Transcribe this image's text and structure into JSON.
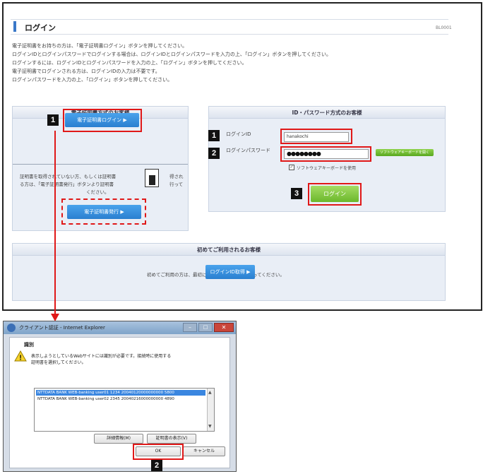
{
  "page": {
    "title": "ログイン",
    "code": "BL0001",
    "instructions": [
      "電子証明書をお持ちの方は、「電子証明書ログイン」ボタンを押してください。",
      "ログインIDとログインパスワードでログインする場合は、ログインIDとログインパスワードを入力の上、「ログイン」ボタンを押してください。",
      "ログインするには、ログインIDとログインパスワードを入力の上、「ログイン」ボタンを押してください。",
      "電子証明書でログインされる方は、ログインIDの入力は不要です。",
      "ログインパスワードを入力の上、「ログイン」ボタンを押してください。"
    ]
  },
  "cert_panel": {
    "heading": "電子証明書方式のお客様",
    "login_button": "電子証明書ログイン ▶",
    "note_line1": "証明書を取得されていない方、もしくは証明書",
    "note_line1b": "得され",
    "note_line2": "る方は、「電子証明書発行」ボタンより証明書",
    "note_line2b": "行って",
    "note_line3": "ください。",
    "issue_button": "電子証明書発行 ▶"
  },
  "id_panel": {
    "heading": "ID・パスワード方式のお客様",
    "id_label": "ログインID",
    "id_value": "hanakochi",
    "password_label": "ログインパスワード",
    "password_value": "●●●●●●●●",
    "software_keyboard_button": "ソフトウェアキーボードを開く",
    "software_keyboard_checkbox": "ソフトウェアキーボードを使用",
    "login_button": "ログイン"
  },
  "first_panel": {
    "heading": "初めてご利用されるお客様",
    "text": "初めてご利用の方は、最初にログインIDの取得を行ってください。",
    "button": "ログインID取得 ▶"
  },
  "markers": {
    "m1a": "1",
    "m1b": "1",
    "m2a": "2",
    "m3": "3",
    "m2b": "2"
  },
  "dialog": {
    "title": "クライアント認証 - Internet Explorer",
    "heading": "識別",
    "message_line1": "表示しようとしているWebサイトには識別が必要です。接続時に使用する",
    "message_line2": "証明書を選択してください。",
    "certificates": [
      "NTTDATA BANK WEB-banking user01 1234 20040120000000000 5800",
      "NTTDATA BANK WEB-banking user02 2345 20040216000000000 4890"
    ],
    "details_button": "詳細情報(M)",
    "view_cert_button": "証明書の表示(V)",
    "ok_button": "OK",
    "cancel_button": "キャンセル"
  },
  "colors": {
    "accent_blue": "#2a7fd0",
    "highlight_red": "#e01818",
    "login_green": "#7cc23a"
  }
}
